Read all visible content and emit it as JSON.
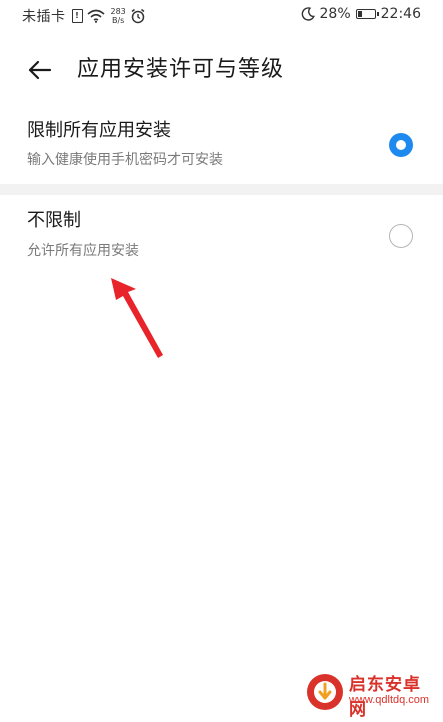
{
  "status_bar": {
    "carrier": "未插卡",
    "sim_label": "!",
    "speed_value": "283",
    "speed_unit": "B/s",
    "battery_text": "28%",
    "battery_level": 0.28,
    "time": "22:46",
    "icons": [
      "sim-icon",
      "wifi-icon",
      "alarm-icon",
      "moon-icon",
      "battery-icon"
    ]
  },
  "header": {
    "back_icon": "arrow-left-icon",
    "title": "应用安装许可与等级"
  },
  "options": [
    {
      "title": "限制所有应用安装",
      "description": "输入健康使用手机密码才可安装",
      "selected": true
    },
    {
      "title": "不限制",
      "description": "允许所有应用安装",
      "selected": false
    }
  ],
  "colors": {
    "accent": "#1e8af0",
    "annotation": "#e8232a",
    "watermark": "#d9322b"
  },
  "watermark": {
    "title": "启东安卓网",
    "url": "www.qdltdq.com"
  }
}
